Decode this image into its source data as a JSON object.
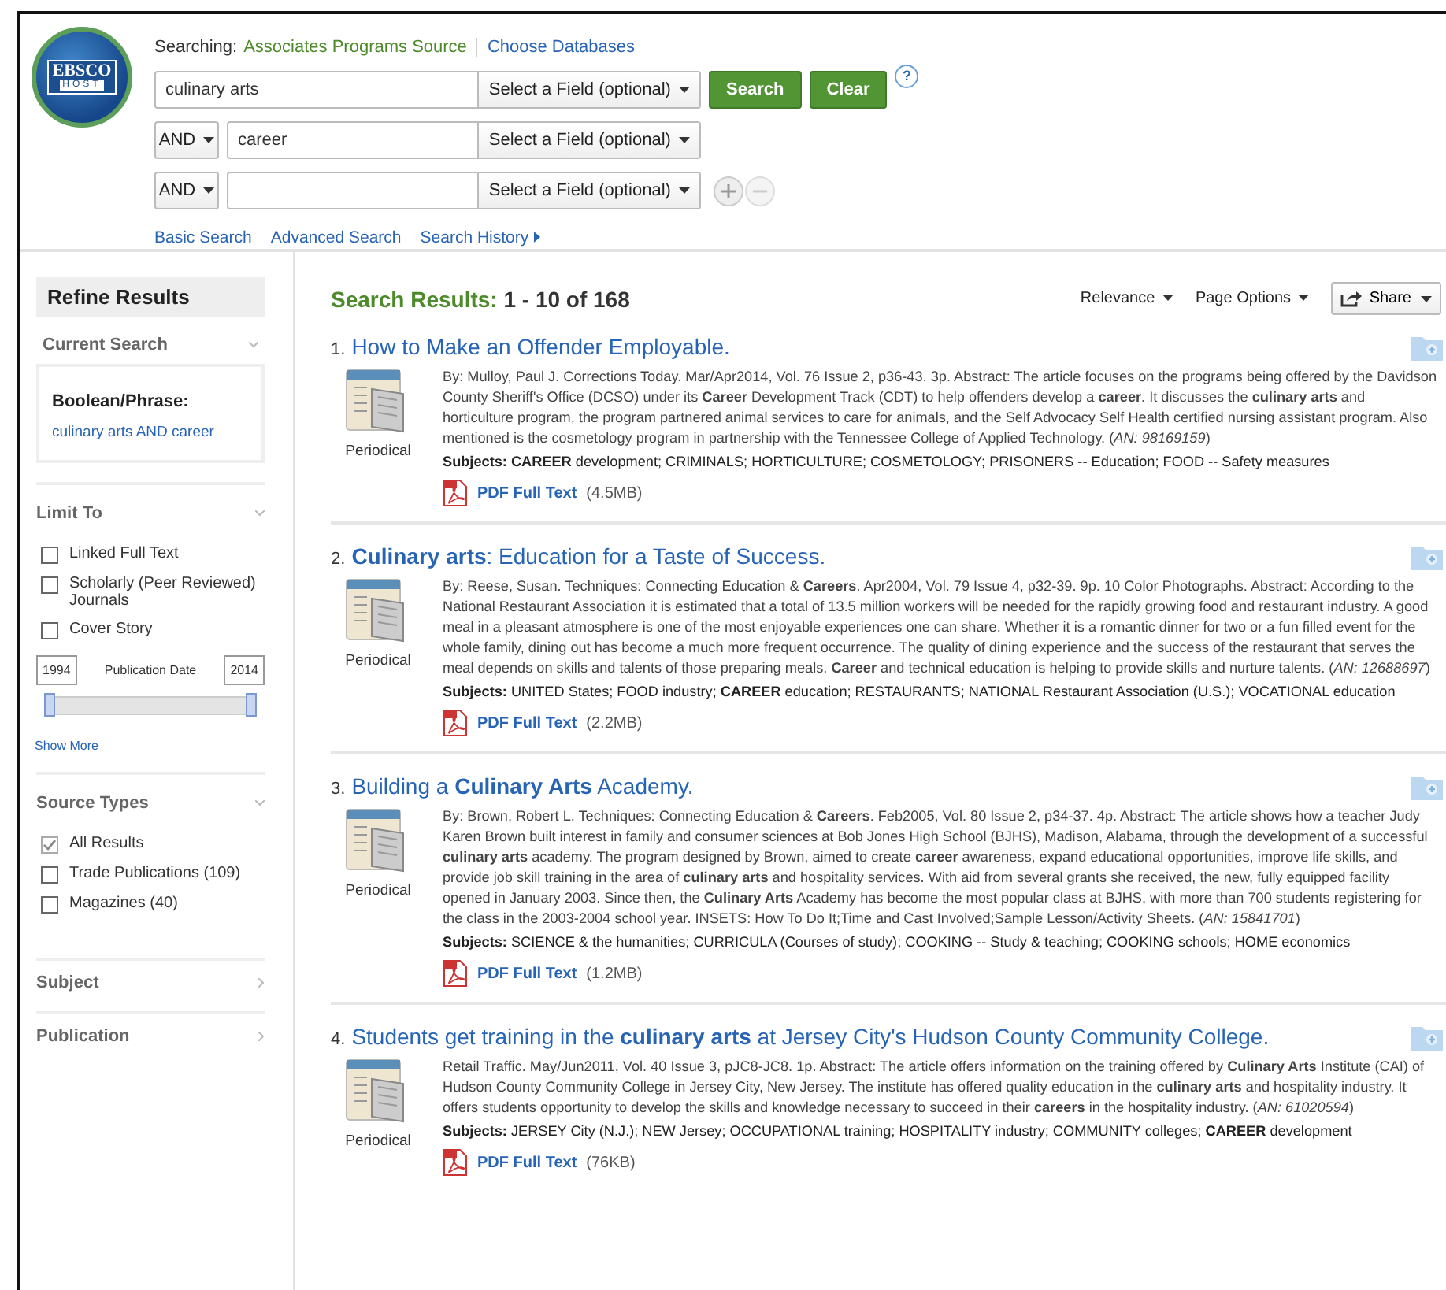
{
  "logo": {
    "top": "EBSCO",
    "bottom": "HOST"
  },
  "searching": {
    "label": "Searching:",
    "database": "Associates Programs Source",
    "choose": "Choose Databases"
  },
  "search_rows": [
    {
      "value": "culinary arts",
      "field": "Select a Field (optional)"
    },
    {
      "operator": "AND",
      "value": "career",
      "field": "Select a Field (optional)"
    },
    {
      "operator": "AND",
      "field": "Select a Field (optional)"
    }
  ],
  "buttons": [
    {
      "kind": "primary",
      "label": "Search"
    },
    {
      "kind": "primary",
      "label": "Clear"
    },
    {
      "kind": "help",
      "label": "?"
    }
  ],
  "links": [
    {
      "label": "Basic Search"
    },
    {
      "label": "Advanced Search"
    },
    {
      "label": "Search History",
      "arrow": true
    }
  ],
  "sidebar": {
    "title": "Refine Results",
    "current_search": {
      "heading": "Current Search",
      "label": "Boolean/Phrase:",
      "query": "culinary arts AND career"
    },
    "limit_to": {
      "heading": "Limit To",
      "options": [
        {
          "label": "Linked Full Text",
          "checked": false
        },
        {
          "label": "Scholarly (Peer Reviewed) Journals",
          "checked": false
        },
        {
          "label": "Cover Story",
          "checked": false
        }
      ],
      "date_from": "1994",
      "date_label": "Publication Date",
      "date_to": "2014",
      "slider": {
        "level": 1
      },
      "show_more": "Show More"
    },
    "source_types": {
      "heading": "Source Types",
      "options": [
        {
          "label": "All Results",
          "checked": true
        },
        {
          "label": "Trade Publications (109)",
          "checked": false
        },
        {
          "label": "Magazines (40)",
          "checked": false
        }
      ]
    },
    "collapsed": [
      {
        "heading": "Subject"
      },
      {
        "heading": "Publication"
      }
    ]
  },
  "results_header": {
    "label": "Search Results:",
    "range": "1 - 10 of 168",
    "controls": [
      {
        "kind": "menu",
        "label": "Relevance"
      },
      {
        "kind": "menu",
        "label": "Page Options"
      },
      {
        "kind": "share",
        "label": "Share"
      }
    ]
  },
  "results": [
    {
      "number": "1.",
      "title": "How to Make an Offender Employable.",
      "type": "Periodical",
      "abstract": "By: Mulloy, Paul J. Corrections Today. Mar/Apr2014, Vol. 76 Issue 2, p36-43. 3p. Abstract: The article focuses on the programs being offered by the Davidson County Sheriff's Office (DCSO) under its **Career** Development Track (CDT) to help offenders develop a **career**. It discusses the **culinary arts** and horticulture program, the program partnered animal services to care for animals, and the Self Advocacy Self Health certified nursing assistant program. Also mentioned is the cosmetology program in partnership with the Tennessee College of Applied Technology. (*AN: 98169159*)",
      "subjects_label": "Subjects:",
      "subjects": "**CAREER** development; CRIMINALS; HORTICULTURE; COSMETOLOGY; PRISONERS -- Education; FOOD -- Safety measures",
      "pdf": "PDF Full Text",
      "size": "(4.5MB)"
    },
    {
      "number": "2.",
      "title": "**Culinary arts**: Education for a Taste of Success.",
      "type": "Periodical",
      "abstract": "By: Reese, Susan. Techniques: Connecting Education & **Careers**. Apr2004, Vol. 79 Issue 4, p32-39. 9p. 10 Color Photographs. Abstract: According to the National Restaurant Association it is estimated that a total of 13.5 million workers will be needed for the rapidly growing food and restaurant industry. A good meal in a pleasant atmosphere is one of the most enjoyable experiences one can share. Whether it is a romantic dinner for two or a fun filled event for the whole family, dining out has become a much more frequent occurrence. The quality of dining experience and the success of the restaurant that serves the meal depends on skills and talents of those preparing meals. **Career** and technical education is helping to provide skills and nurture talents. (*AN: 12688697*)",
      "subjects_label": "Subjects:",
      "subjects": "UNITED States; FOOD industry; **CAREER** education; RESTAURANTS; NATIONAL Restaurant Association (U.S.); VOCATIONAL education",
      "pdf": "PDF Full Text",
      "size": "(2.2MB)"
    },
    {
      "number": "3.",
      "title": "Building a **Culinary Arts** Academy.",
      "type": "Periodical",
      "abstract": "By: Brown, Robert L. Techniques: Connecting Education & **Careers**. Feb2005, Vol. 80 Issue 2, p34-37. 4p. Abstract: The article shows how a teacher Judy Karen Brown built interest in family and consumer sciences at Bob Jones High School (BJHS), Madison, Alabama, through the development of a successful **culinary arts** academy. The program designed by Brown, aimed to create **career** awareness, expand educational opportunities, improve life skills, and provide job skill training in the area of **culinary arts** and hospitality services. With aid from several grants she received, the new, fully equipped facility opened in January 2003. Since then, the **Culinary Arts** Academy has become the most popular class at BJHS, with more than 700 students registering for the class in the 2003-2004 school year. INSETS: How To Do It;Time and Cast Involved;Sample Lesson/Activity Sheets. (*AN: 15841701*)",
      "subjects_label": "Subjects:",
      "subjects": "SCIENCE & the humanities; CURRICULA (Courses of study); COOKING -- Study & teaching; COOKING schools; HOME economics",
      "pdf": "PDF Full Text",
      "size": "(1.2MB)"
    },
    {
      "number": "4.",
      "title": "Students get training in the **culinary arts** at Jersey City's Hudson County Community College.",
      "type": "Periodical",
      "abstract": "Retail Traffic. May/Jun2011, Vol. 40 Issue 3, pJC8-JC8. 1p. Abstract: The article offers information on the training offered by **Culinary Arts** Institute (CAI) of Hudson County Community College in Jersey City, New Jersey. The institute has offered quality education in the **culinary arts** and hospitality industry. It offers students opportunity to develop the skills and knowledge necessary to succeed in their **careers** in the hospitality industry. (*AN: 61020594*)",
      "subjects_label": "Subjects:",
      "subjects": "JERSEY City (N.J.); NEW Jersey; OCCUPATIONAL training; HOSPITALITY industry; COMMUNITY colleges; **CAREER** development",
      "pdf": "PDF Full Text",
      "size": "(76KB)"
    }
  ]
}
